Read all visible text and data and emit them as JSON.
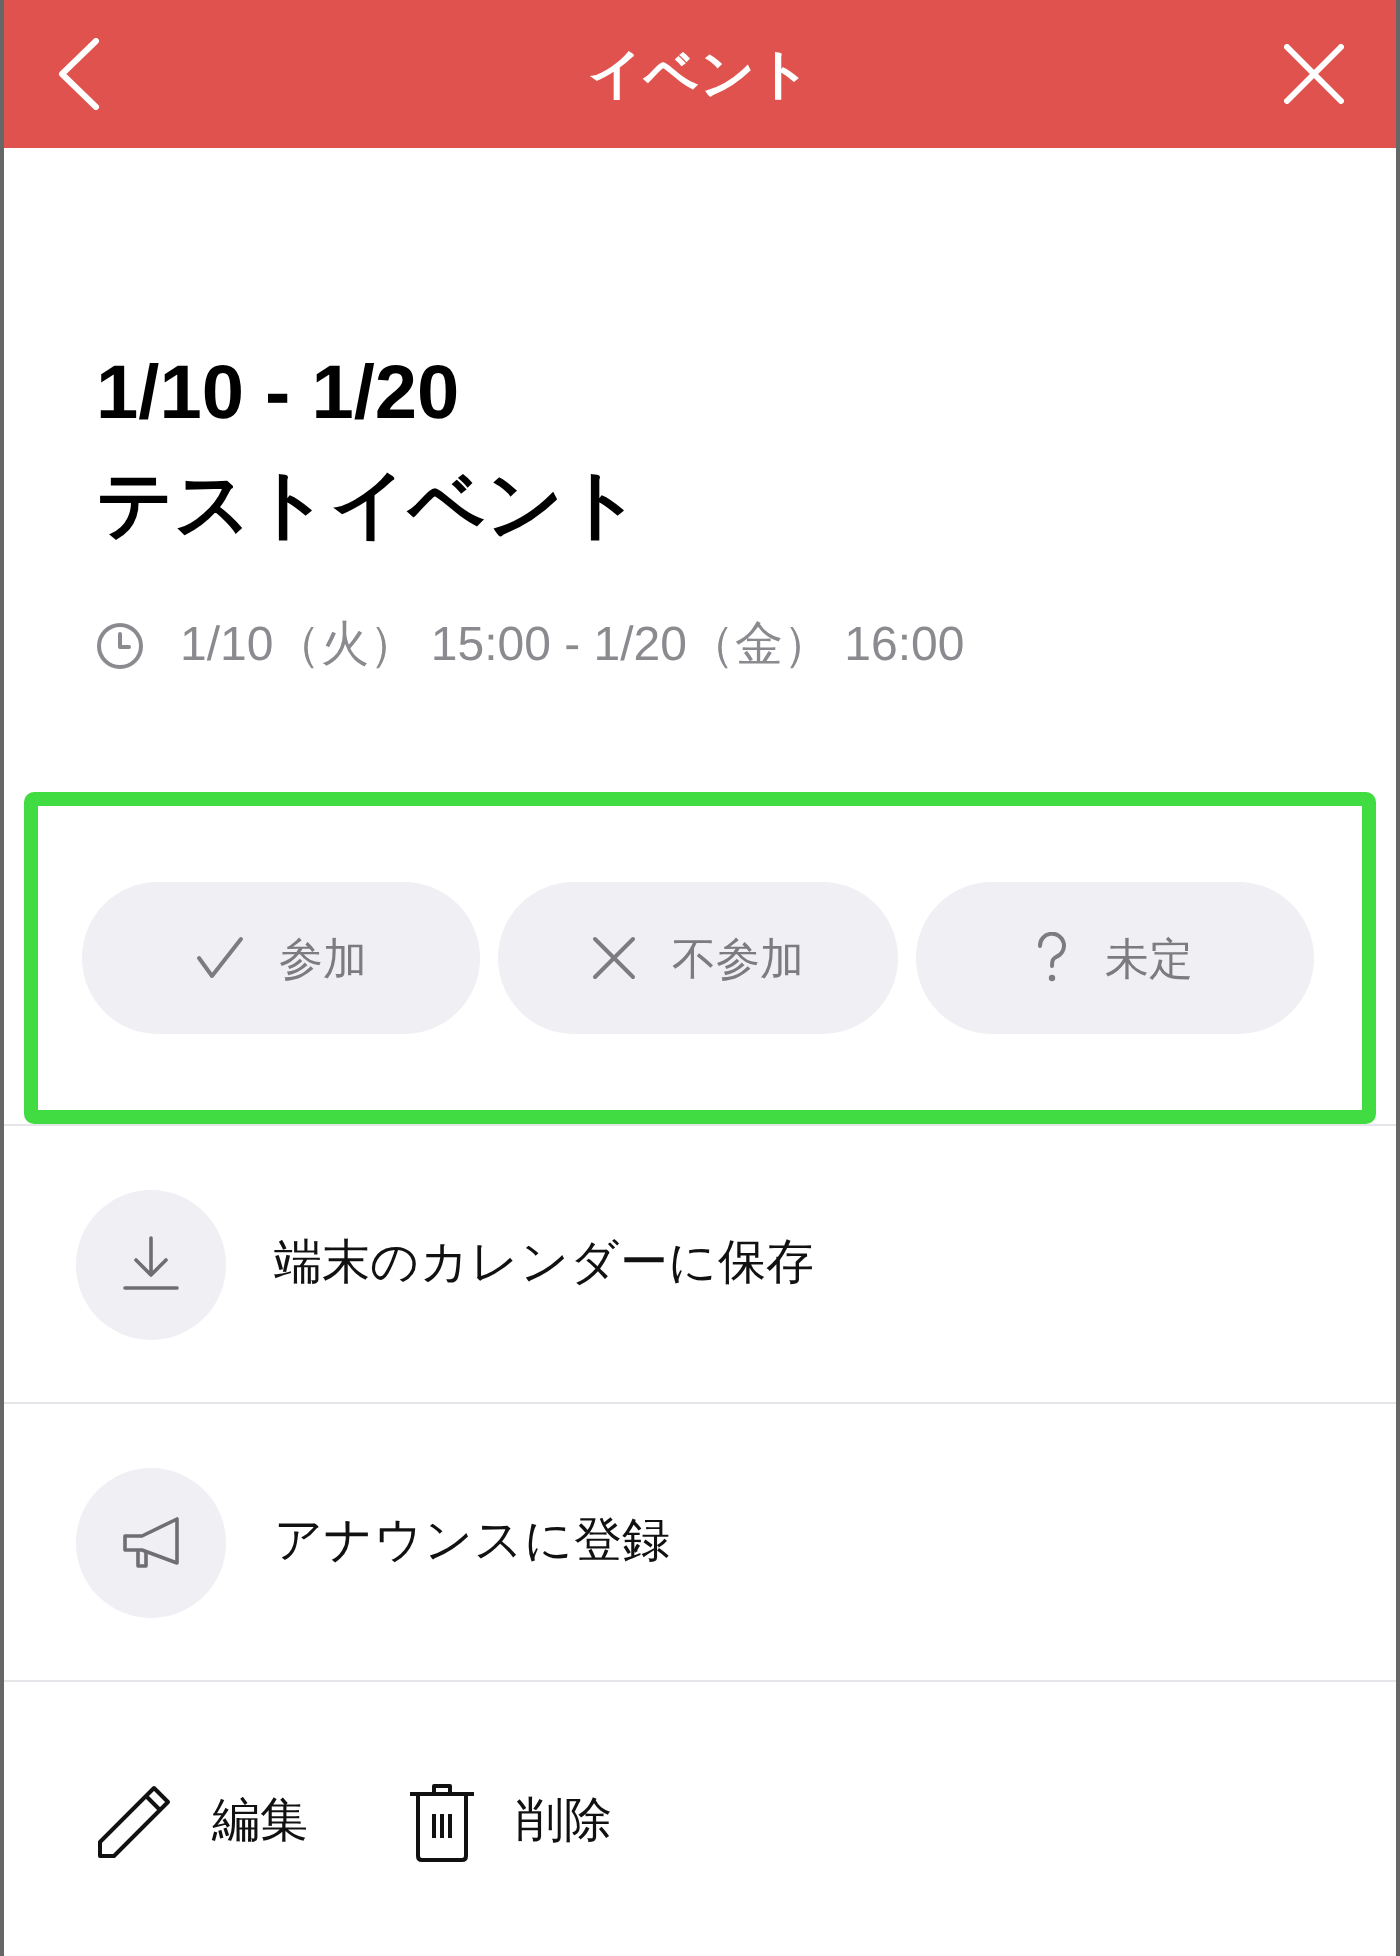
{
  "header": {
    "title": "イベント"
  },
  "event": {
    "date_range": "1/10 - 1/20",
    "name": "テストイベント",
    "schedule": "1/10（火） 15:00 - 1/20（金） 16:00"
  },
  "rsvp": {
    "highlighted": true,
    "options": [
      {
        "kind": "attend",
        "label": "参加",
        "selected": false
      },
      {
        "kind": "decline",
        "label": "不参加",
        "selected": false
      },
      {
        "kind": "undecided",
        "label": "未定",
        "selected": false
      }
    ]
  },
  "actions": [
    {
      "kind": "download",
      "label": "端末のカレンダーに保存"
    },
    {
      "kind": "announce",
      "label": "アナウンスに登録"
    }
  ],
  "footer_actions": [
    {
      "kind": "edit",
      "label": "編集"
    },
    {
      "kind": "delete",
      "label": "削除"
    }
  ]
}
